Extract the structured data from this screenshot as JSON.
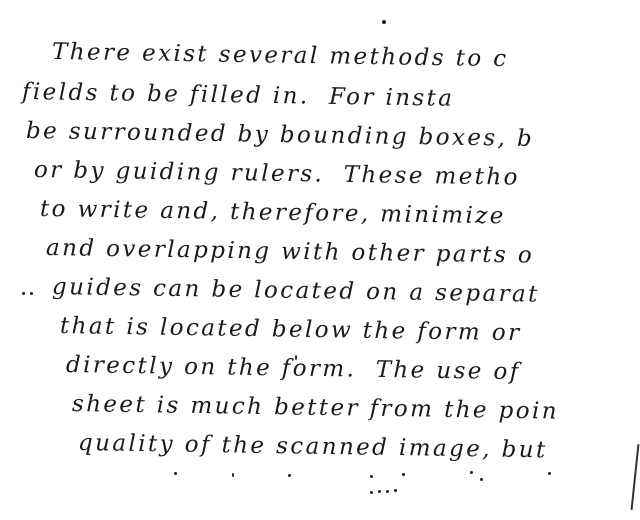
{
  "document": {
    "lines": [
      "There exist several methods to c",
      "fields to be filled in.  For insta",
      "be surrounded by bounding boxes, b",
      "or by guiding rulers.  These metho",
      "to write and, therefore, minimize",
      "and overlapping with other parts o",
      "guides can be located on a separat",
      "that is located below the form or",
      "directly on the form.  The use of",
      "sheet is much better from the poin",
      "quality of the scanned image, but"
    ]
  }
}
